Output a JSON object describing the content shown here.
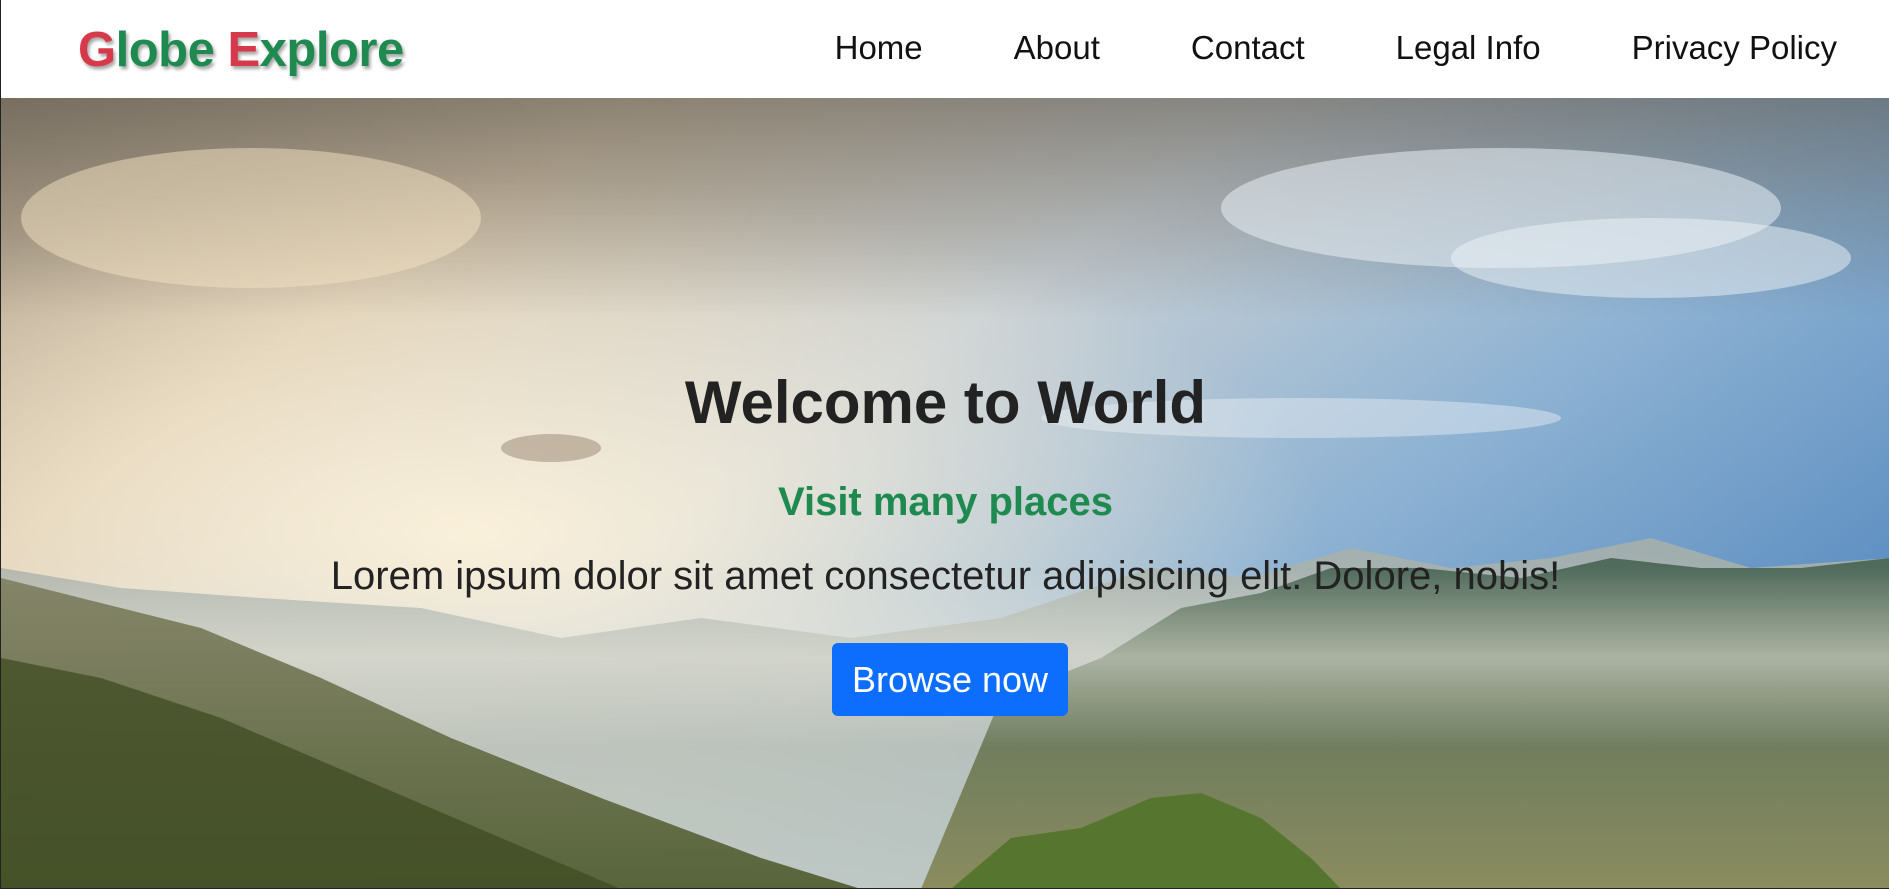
{
  "brand": {
    "part1_initial": "G",
    "part1_rest": "lobe ",
    "part2_initial": "E",
    "part2_rest": "xplore",
    "colors": {
      "accent_red": "#d63a4a",
      "accent_green": "#1e8a4f"
    }
  },
  "nav": {
    "items": [
      {
        "label": "Home"
      },
      {
        "label": "About"
      },
      {
        "label": "Contact"
      },
      {
        "label": "Legal Info"
      },
      {
        "label": "Privacy Policy"
      }
    ]
  },
  "hero": {
    "title": "Welcome to World",
    "subtitle": "Visit many places",
    "text": "Lorem ipsum dolor sit amet consectetur adipisicing elit. Dolore, nobis!",
    "button_label": "Browse now",
    "button_color": "#0d6efd",
    "background": "mountain-landscape-image"
  }
}
